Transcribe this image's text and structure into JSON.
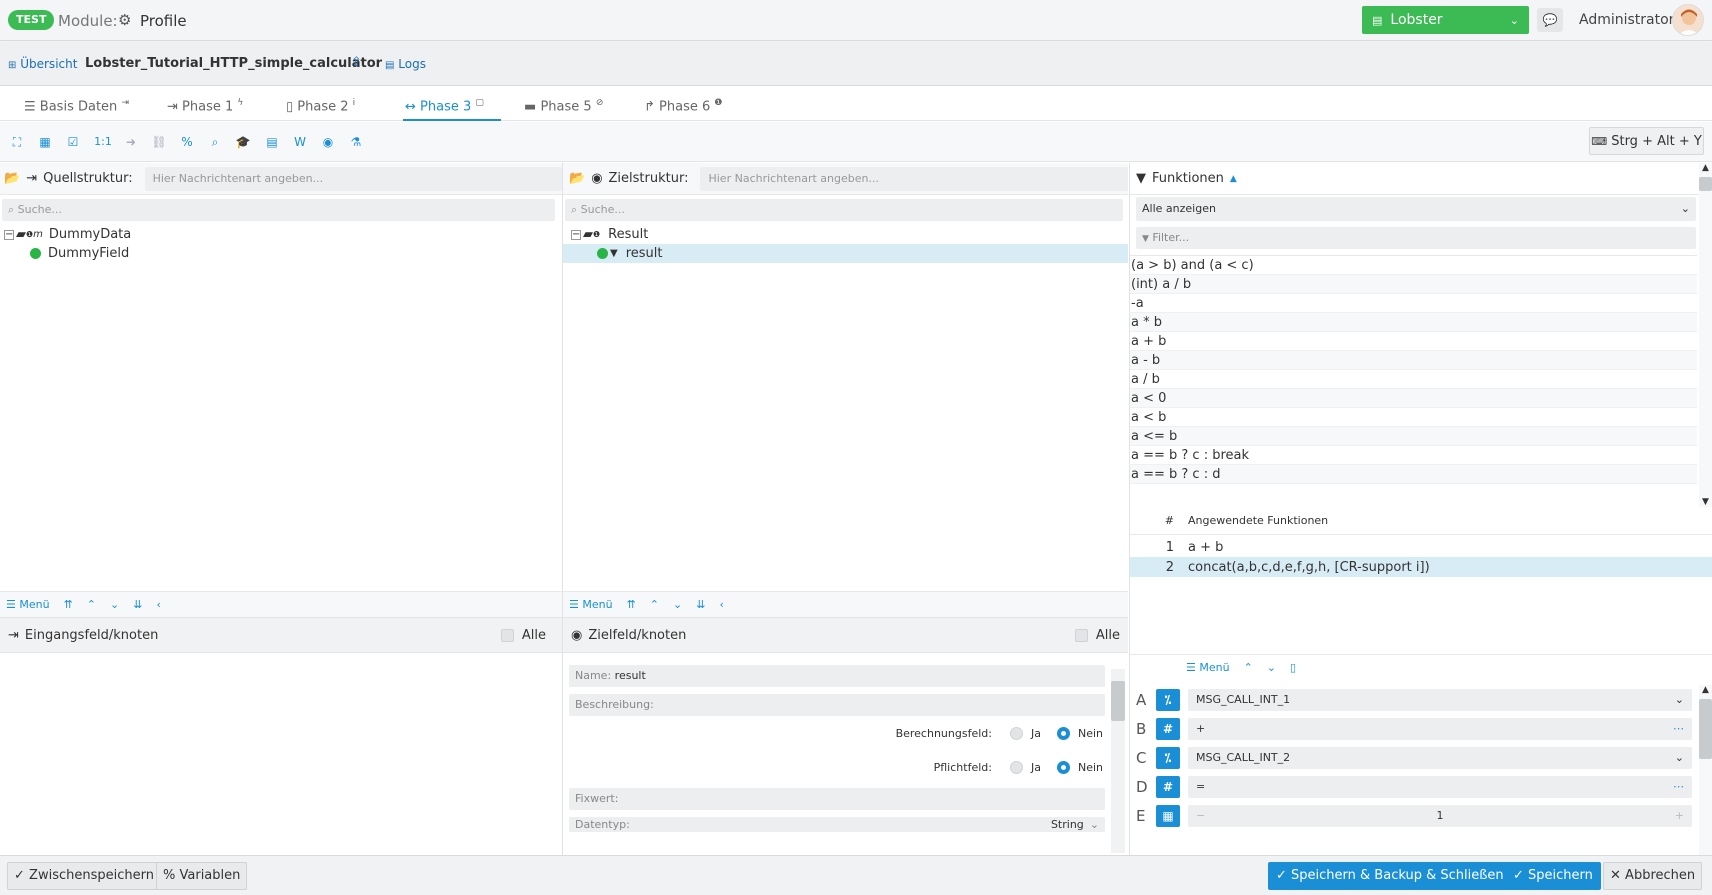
{
  "topbar": {
    "badge": "TEST",
    "module_label": "Module:",
    "module_name": "Profile",
    "profile_select": "Lobster",
    "user": "Administrator"
  },
  "breadcrumb": {
    "overview": "Übersicht",
    "title": "Lobster_Tutorial_HTTP_simple_calculator",
    "logs": "Logs"
  },
  "tabs": [
    {
      "label": "Basis Daten"
    },
    {
      "label": "Phase 1"
    },
    {
      "label": "Phase 2"
    },
    {
      "label": "Phase 3"
    },
    {
      "label": "Phase 5"
    },
    {
      "label": "Phase 6"
    }
  ],
  "toolbar": {
    "one_to_one": "1:1",
    "shortcut": "Strg + Alt + Y"
  },
  "source": {
    "label": "Quellstruktur:",
    "placeholder": "Hier Nachrichtenart angeben...",
    "search": "Suche...",
    "tree": [
      "DummyData",
      "DummyField"
    ],
    "menu": "Menü",
    "input_head": "Eingangsfeld/knoten",
    "all": "Alle"
  },
  "target": {
    "label": "Zielstruktur:",
    "placeholder": "Hier Nachrichtenart angeben...",
    "search": "Suche...",
    "tree": [
      "Result",
      "result"
    ],
    "menu": "Menü",
    "field_head": "Zielfeld/knoten",
    "all": "Alle",
    "name_label": "Name:",
    "name_value": "result",
    "description": "Beschreibung:",
    "calc_field": "Berechnungsfeld:",
    "required_field": "Pflichtfeld:",
    "yes": "Ja",
    "no": "Nein",
    "fixed_value": "Fixwert:",
    "datatype": "Datentyp:",
    "datatype_value": "String"
  },
  "functions": {
    "title": "Funktionen",
    "show_all": "Alle anzeigen",
    "filter": "Filter...",
    "list": [
      "(a > b) and (a < c)",
      "(int) a / b",
      "-a",
      "a * b",
      "a + b",
      "a - b",
      "a / b",
      "a < 0",
      "a < b",
      "a <= b",
      "a == b ? c : break",
      "a == b ? c : d"
    ],
    "applied_hash": "#",
    "applied_title": "Angewendete Funktionen",
    "applied": [
      {
        "n": "1",
        "f": "a + b"
      },
      {
        "n": "2",
        "f": "concat(a,b,c,d,e,f,g,h, [CR-support i])"
      }
    ],
    "menu": "Menü",
    "params": [
      {
        "letter": "A",
        "icon": "⁒",
        "value": "MSG_CALL_INT_1",
        "kind": "select"
      },
      {
        "letter": "B",
        "icon": "#",
        "value": "+",
        "kind": "text"
      },
      {
        "letter": "C",
        "icon": "⁒",
        "value": "MSG_CALL_INT_2",
        "kind": "select"
      },
      {
        "letter": "D",
        "icon": "#",
        "value": "=",
        "kind": "text"
      },
      {
        "letter": "E",
        "icon": "▦",
        "value": "1",
        "kind": "number"
      }
    ]
  },
  "footer": {
    "save_temp": "Zwischenspeichern",
    "variables": "Variablen",
    "save_backup_close": "Speichern & Backup & Schließen",
    "save": "Speichern",
    "cancel": "Abbrechen"
  }
}
